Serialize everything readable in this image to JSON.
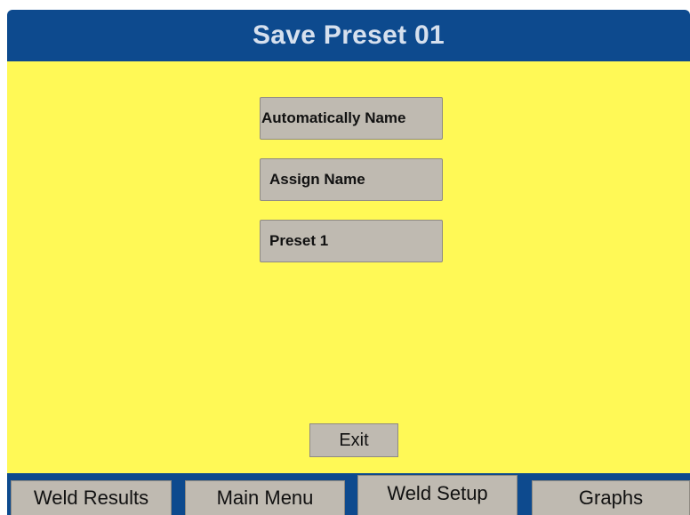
{
  "header": {
    "title": "Save Preset 01"
  },
  "menu": {
    "automatically_name": "Automatically Name",
    "assign_name": "Assign Name",
    "preset_name": "Preset 1"
  },
  "exit_label": "Exit",
  "tabs": [
    {
      "label": "Weld Results"
    },
    {
      "label": "Main Menu"
    },
    {
      "label": "Weld Setup",
      "selected": true
    },
    {
      "label": "Graphs"
    }
  ],
  "colors": {
    "header_bg": "#0d4a8e",
    "panel_bg": "#fff956",
    "button_bg": "#bfbab1"
  }
}
